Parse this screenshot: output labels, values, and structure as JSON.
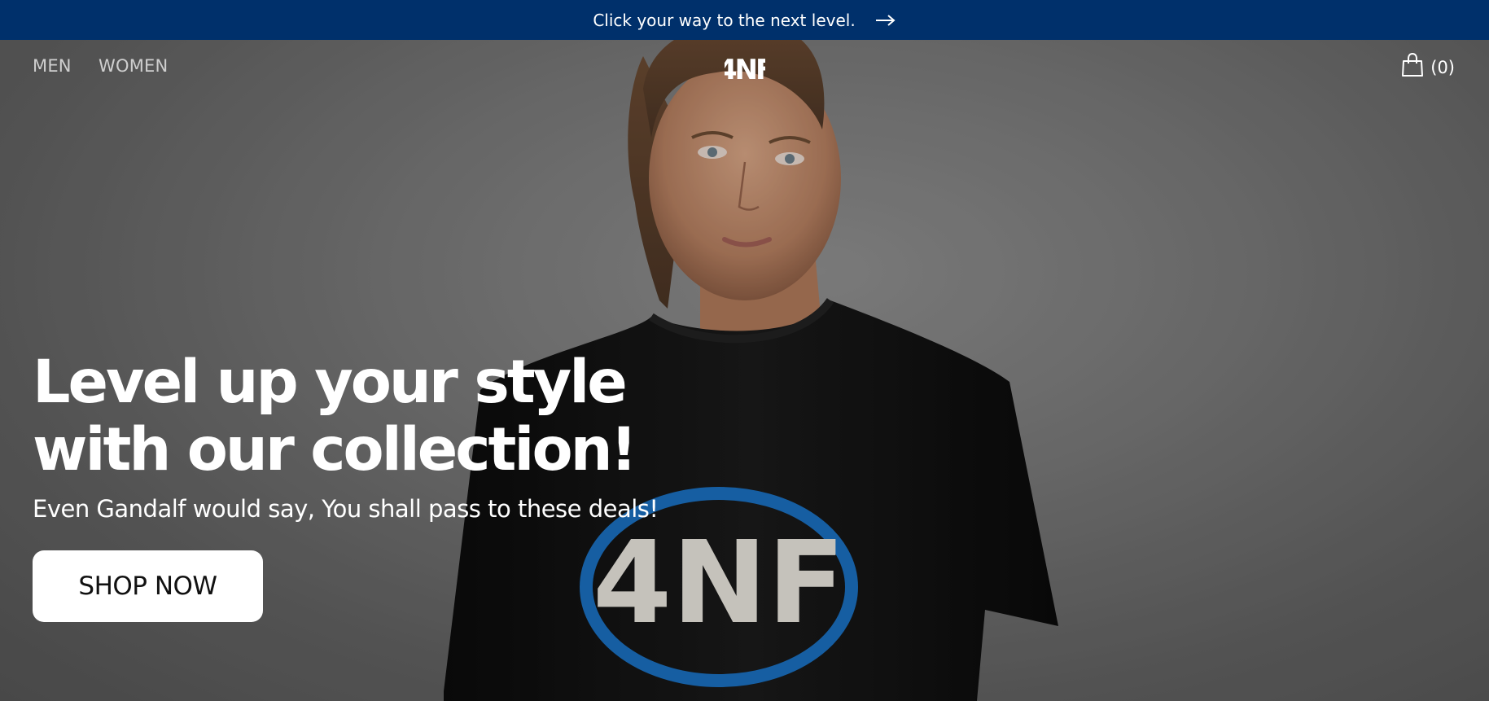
{
  "promo": {
    "text": "Click your way to the next level.",
    "icon": "arrow-right-icon"
  },
  "nav": {
    "items": [
      {
        "label": "MEN"
      },
      {
        "label": "WOMEN"
      }
    ]
  },
  "brand": {
    "logo_text": "4NF"
  },
  "cart": {
    "count_label": "(0)",
    "icon": "shopping-bag-icon"
  },
  "hero": {
    "headline_line1": "Level up your style",
    "headline_line2": "with our collection!",
    "subtext": "Even Gandalf would say, You shall pass to these deals!",
    "cta_label": "SHOP NOW",
    "shirt_print": "4NF"
  },
  "colors": {
    "promo_bg": "#00306b",
    "cta_bg": "#ffffff",
    "shirt": "#111111",
    "shirt_logo_ring": "#1a6fbf"
  }
}
